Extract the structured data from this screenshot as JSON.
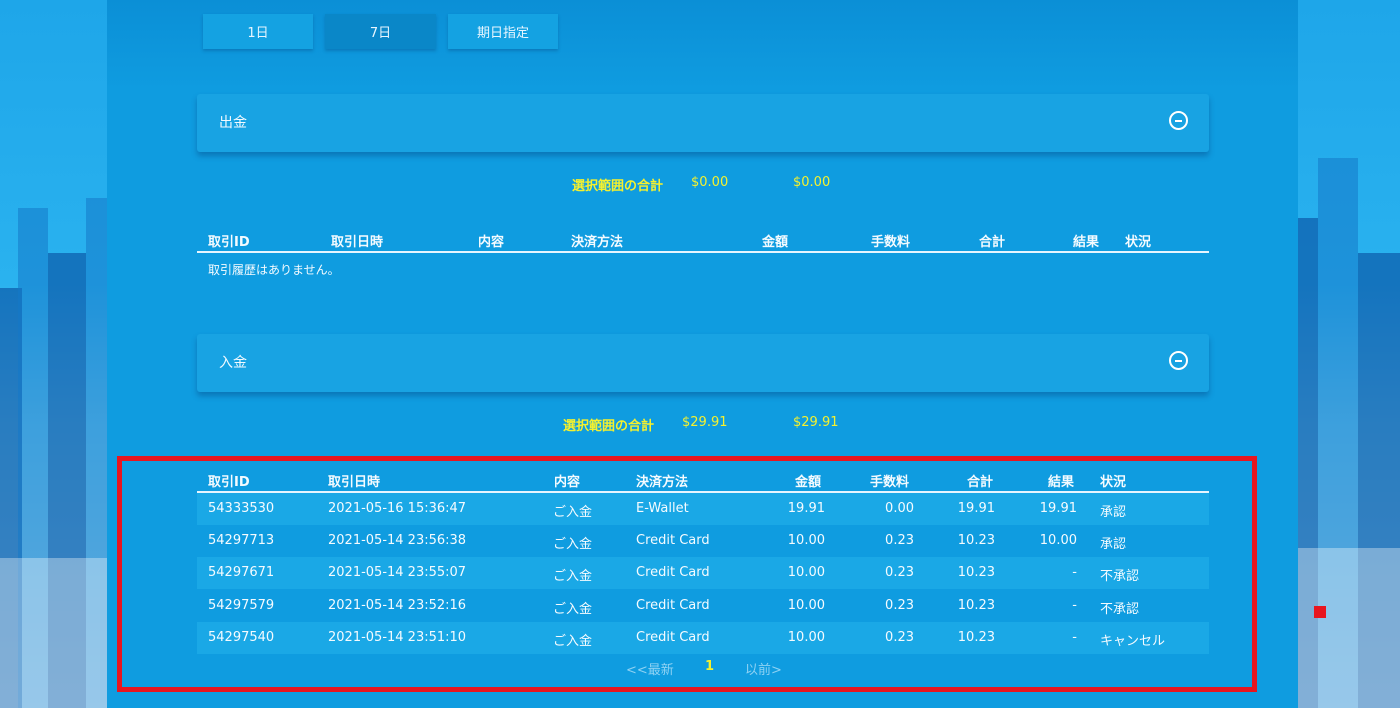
{
  "tabs": [
    {
      "label": "1日",
      "active": false
    },
    {
      "label": "7日",
      "active": true
    },
    {
      "label": "期日指定",
      "active": false
    }
  ],
  "withdrawal": {
    "title": "出金",
    "totals_label": "選択範囲の合計",
    "total_amount": "$0.00",
    "total_sum": "$0.00",
    "columns": [
      "取引ID",
      "取引日時",
      "内容",
      "決済方法",
      "金額",
      "手数料",
      "合計",
      "結果",
      "状況"
    ],
    "empty_message": "取引履歴はありません。"
  },
  "deposit": {
    "title": "入金",
    "totals_label": "選択範囲の合計",
    "total_amount": "$29.91",
    "total_sum": "$29.91",
    "columns": [
      "取引ID",
      "取引日時",
      "内容",
      "決済方法",
      "金額",
      "手数料",
      "合計",
      "結果",
      "状況"
    ],
    "rows": [
      {
        "id": "54333530",
        "datetime": "2021-05-16 15:36:47",
        "content": "ご入金",
        "method": "E-Wallet",
        "amount": "19.91",
        "fee": "0.00",
        "total": "19.91",
        "result": "19.91",
        "status": "承認"
      },
      {
        "id": "54297713",
        "datetime": "2021-05-14 23:56:38",
        "content": "ご入金",
        "method": "Credit Card",
        "amount": "10.00",
        "fee": "0.23",
        "total": "10.23",
        "result": "10.00",
        "status": "承認"
      },
      {
        "id": "54297671",
        "datetime": "2021-05-14 23:55:07",
        "content": "ご入金",
        "method": "Credit Card",
        "amount": "10.00",
        "fee": "0.23",
        "total": "10.23",
        "result": "-",
        "status": "不承認"
      },
      {
        "id": "54297579",
        "datetime": "2021-05-14 23:52:16",
        "content": "ご入金",
        "method": "Credit Card",
        "amount": "10.00",
        "fee": "0.23",
        "total": "10.23",
        "result": "-",
        "status": "不承認"
      },
      {
        "id": "54297540",
        "datetime": "2021-05-14 23:51:10",
        "content": "ご入金",
        "method": "Credit Card",
        "amount": "10.00",
        "fee": "0.23",
        "total": "10.23",
        "result": "-",
        "status": "キャンセル"
      }
    ]
  },
  "pager": {
    "prev": "<<最新",
    "current": "1",
    "next": "以前>"
  },
  "colors": {
    "accent_yellow": "#f5f12e",
    "highlight_red": "#e8151f",
    "background_blue": "#0f9ce0"
  }
}
